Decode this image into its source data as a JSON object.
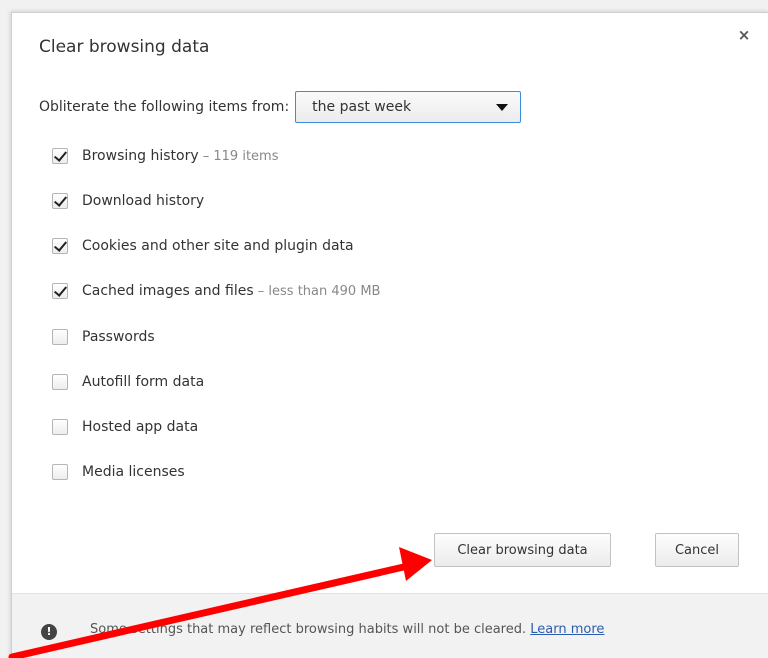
{
  "dialog": {
    "title": "Clear browsing data",
    "close_symbol": "×"
  },
  "time_range": {
    "label": "Obliterate the following items from:",
    "selected": "the past week"
  },
  "items": [
    {
      "label": "Browsing history",
      "detail": " – 119 items",
      "checked": true
    },
    {
      "label": "Download history",
      "detail": "",
      "checked": true
    },
    {
      "label": "Cookies and other site and plugin data",
      "detail": "",
      "checked": true
    },
    {
      "label": "Cached images and files",
      "detail": " – less than 490 MB",
      "checked": true
    },
    {
      "label": "Passwords",
      "detail": "",
      "checked": false
    },
    {
      "label": "Autofill form data",
      "detail": "",
      "checked": false
    },
    {
      "label": "Hosted app data",
      "detail": "",
      "checked": false
    },
    {
      "label": "Media licenses",
      "detail": "",
      "checked": false
    }
  ],
  "buttons": {
    "clear": "Clear browsing data",
    "cancel": "Cancel"
  },
  "footer": {
    "icon": "info-icon",
    "icon_glyph": "!",
    "text": "Some settings that may reflect browsing habits will not be cleared. ",
    "link": "Learn more"
  },
  "annotation": {
    "color": "#ff0000"
  }
}
